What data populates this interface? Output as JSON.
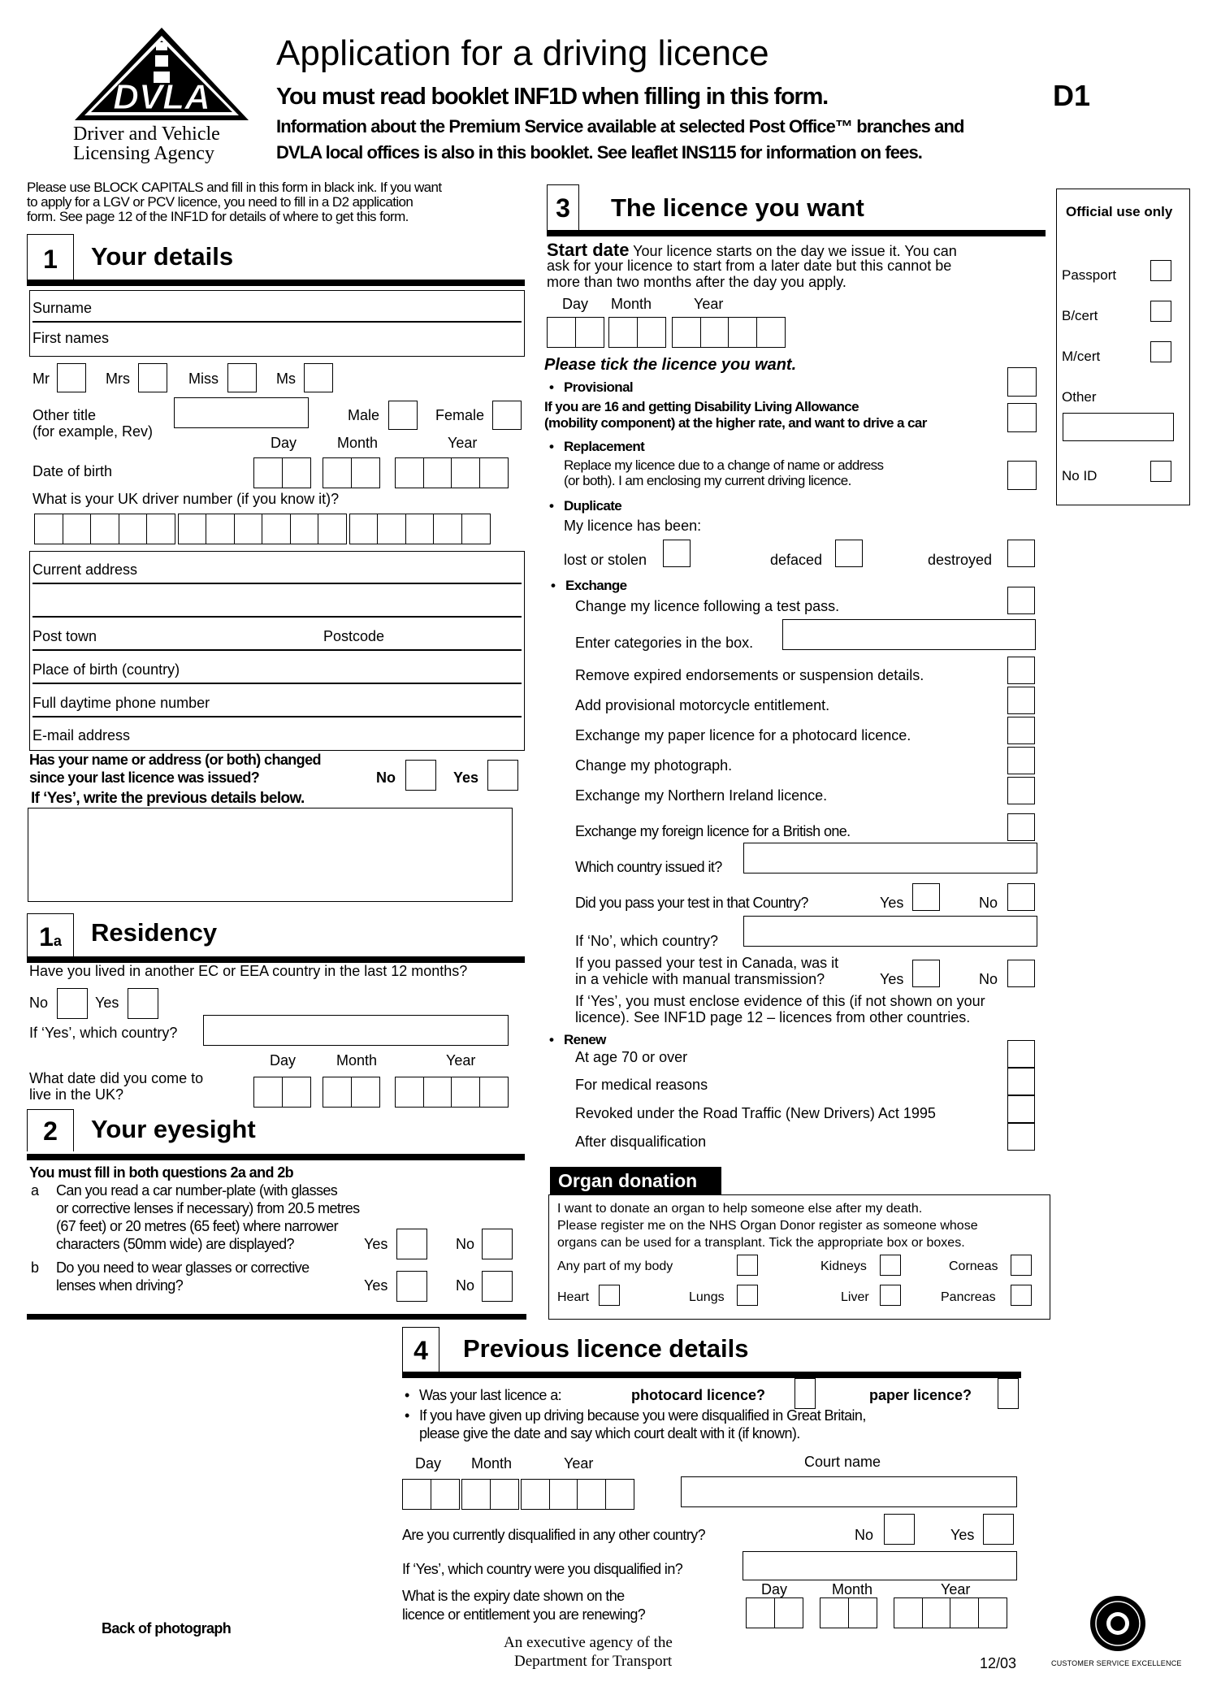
{
  "header": {
    "logo_text": "DVLA",
    "agency_line1": "Driver and Vehicle",
    "agency_line2": "Licensing Agency",
    "title": "Application for a driving licence",
    "subtitle": "You must read booklet INF1D when filling in this form.",
    "info_line1": "Information about the Premium Service available at selected Post Office™ branches and",
    "info_line2": "DVLA local offices is also in this booklet. See leaflet INS115 for information on fees.",
    "form_code": "D1"
  },
  "intro": {
    "line1": "Please use BLOCK CAPITALS and fill in this form in black ink. If you want",
    "line2": "to apply for a LGV or PCV licence, you need to fill in a D2 application",
    "line3": "form. See page 12 of the INF1D for details of where to get this form."
  },
  "date_labels": {
    "day": "Day",
    "month": "Month",
    "year": "Year"
  },
  "section1": {
    "number": "1",
    "title": "Your details",
    "surname": "Surname",
    "first_names": "First names",
    "titles": [
      "Mr",
      "Mrs",
      "Miss",
      "Ms"
    ],
    "other_title": "Other title",
    "other_title_hint": "(for example, Rev)",
    "male": "Male",
    "female": "Female",
    "dob": "Date of birth",
    "driver_number_q": "What is your UK driver number (if you know it)?",
    "current_address": "Current address",
    "post_town": "Post town",
    "postcode": "Postcode",
    "place_of_birth": "Place of birth (country)",
    "phone": "Full daytime phone number",
    "email": "E-mail address",
    "changed_q1": "Has your name or address (or both) changed",
    "changed_q2": "since your last licence was issued?",
    "no": "No",
    "yes": "Yes",
    "if_yes": "If ‘Yes’, write the previous details below."
  },
  "section1a": {
    "number": "1",
    "suffix": "a",
    "title": "Residency",
    "lived_q": "Have you lived in another EC or EEA country in the last 12 months?",
    "no": "No",
    "yes": "Yes",
    "which_country": "If ‘Yes’, which country?",
    "uk_date_q1": "What date did you come to",
    "uk_date_q2": "live in the UK?"
  },
  "section2": {
    "number": "2",
    "title": "Your eyesight",
    "instruction": "You must fill in both questions 2a and 2b",
    "qa_letter": "a",
    "qa_lines": [
      "Can you read a car number-plate (with glasses",
      "or corrective lenses if necessary) from 20.5 metres",
      "(67 feet) or 20 metres (65 feet) where narrower",
      "characters (50mm wide) are displayed?"
    ],
    "qb_letter": "b",
    "qb_lines": [
      "Do you need to wear glasses or corrective",
      "lenses when driving?"
    ],
    "yes": "Yes",
    "no": "No"
  },
  "section3": {
    "number": "3",
    "title": "The licence you want",
    "start_date_label": "Start date",
    "start_date_text1": "Your licence starts on the day we issue it. You can",
    "start_date_text2": "ask for your licence to start from a later date but this cannot be",
    "start_date_text3": "more than two months after the day you apply.",
    "tick_prompt": "Please tick the licence you want.",
    "provisional": "Provisional",
    "dla_line1": "If you are 16 and getting Disability Living Allowance",
    "dla_line2": "(mobility component) at the higher rate, and want to drive a car",
    "replacement": "Replacement",
    "replacement_line1": "Replace my licence due to a change of name or address",
    "replacement_line2": "(or both). I am enclosing my current driving licence.",
    "duplicate": "Duplicate",
    "duplicate_text": "My licence has been:",
    "lost": "lost or stolen",
    "defaced": "defaced",
    "destroyed": "destroyed",
    "exchange": "Exchange",
    "exchange_items": [
      "Change my licence following a test pass.",
      "Enter categories in the box.",
      "Remove expired endorsements or suspension details.",
      "Add provisional motorcycle entitlement.",
      "Exchange my paper licence for a photocard licence.",
      "Change my photograph.",
      "Exchange my Northern Ireland licence.",
      "Exchange my foreign licence for a British one.",
      "Which country issued it?",
      "Did you pass your test in that Country?",
      "If ‘No’, which country?"
    ],
    "canada_line1": "If you passed your test in Canada, was it",
    "canada_line2": "in a vehicle with manual transmission?",
    "evidence_line1": "If ‘Yes’, you must enclose evidence of this (if not shown on your",
    "evidence_line2": "licence). See INF1D page 12 – licences from other countries.",
    "yes": "Yes",
    "no": "No",
    "renew": "Renew",
    "renew_items": [
      "At age 70 or over",
      "For medical reasons",
      "Revoked under the Road Traffic (New Drivers) Act 1995",
      "After disqualification"
    ]
  },
  "organ": {
    "title": "Organ donation",
    "text1": "I want to donate an organ to help someone else after my death.",
    "text2": "Please register me on the NHS Organ Donor register as someone whose",
    "text3": "organs can be used for a transplant. Tick the appropriate box or boxes.",
    "options": [
      "Any part of my body",
      "Kidneys",
      "Corneas",
      "Heart",
      "Lungs",
      "Liver",
      "Pancreas"
    ]
  },
  "official": {
    "title": "Official use only",
    "items": [
      "Passport",
      "B/cert",
      "M/cert",
      "Other",
      "No ID"
    ]
  },
  "section4": {
    "number": "4",
    "title": "Previous licence details",
    "last_licence_q": "Was your last licence a:",
    "photocard": "photocard licence?",
    "paper": "paper licence?",
    "disq_line1": "If you have given up driving because you were disqualified in Great Britain,",
    "disq_line2": "please give the date and say which court dealt with it (if known).",
    "court_name": "Court name",
    "other_country_q": "Are you currently disqualified in any other country?",
    "no": "No",
    "yes": "Yes",
    "which_country": "If ‘Yes’, which country were you disqualified in?",
    "expiry_q1": "What is the expiry date shown on the",
    "expiry_q2": "licence or entitlement you are renewing?"
  },
  "footer": {
    "back_of_photo": "Back of photograph",
    "agency_line1": "An executive agency of the",
    "agency_line2": "Department for Transport",
    "date_code": "12/03",
    "charter_mark": "CUSTOMER SERVICE EXCELLENCE",
    "charter_badge": "CHARTER MARK"
  }
}
